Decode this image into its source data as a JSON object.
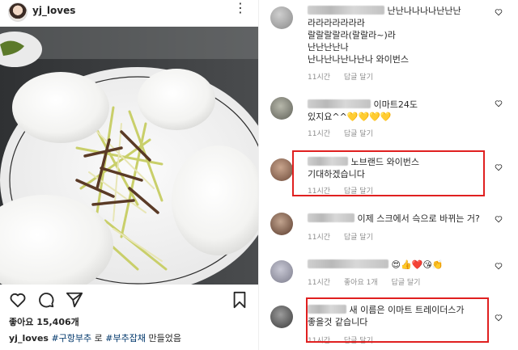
{
  "post": {
    "username": "yj_loves",
    "likes": "좋아요 15,406개",
    "caption_user": "yj_loves",
    "caption_tag1": "#구항부추",
    "caption_mid": "로",
    "caption_tag2": "#부추잡채",
    "caption_end": "만들었음"
  },
  "comments": [
    {
      "lines": [
        "난난나나나나난난난",
        "라라라라라라라",
        "랄랄랄랄라(랄랄라~)라",
        "난난난난나",
        "난나난나난나난나 와이번스"
      ],
      "time": "11시간",
      "reply": "답글 달기"
    },
    {
      "lines": [
        "이마트24도",
        "있지요^^💛💛💛💛"
      ],
      "time": "11시간",
      "reply": "답글 달기"
    },
    {
      "lines": [
        "노브랜드 와이번스",
        "기대하겠습니다"
      ],
      "time": "11시간",
      "reply": "답글 달기"
    },
    {
      "lines": [
        "이제 스크에서 슥으로 바뀌는 거?"
      ],
      "time": "11시간",
      "reply": "답글 달기"
    },
    {
      "lines": [
        "😍👍❤️😘👏"
      ],
      "time": "11시간",
      "likes": "좋아요 1개",
      "reply": "답글 달기"
    },
    {
      "lines": [
        "새 이름은 이마트 트레이더스가",
        "좋을것 같습니다"
      ],
      "time": "11시간",
      "reply": "답글 달기"
    }
  ],
  "icons": [
    "more-icon",
    "heart-icon",
    "comment-icon",
    "share-icon",
    "bookmark-icon"
  ],
  "colors": {
    "highlight_box": "#e02020",
    "hashtag": "#00376b",
    "meta": "#8e8e8e"
  }
}
